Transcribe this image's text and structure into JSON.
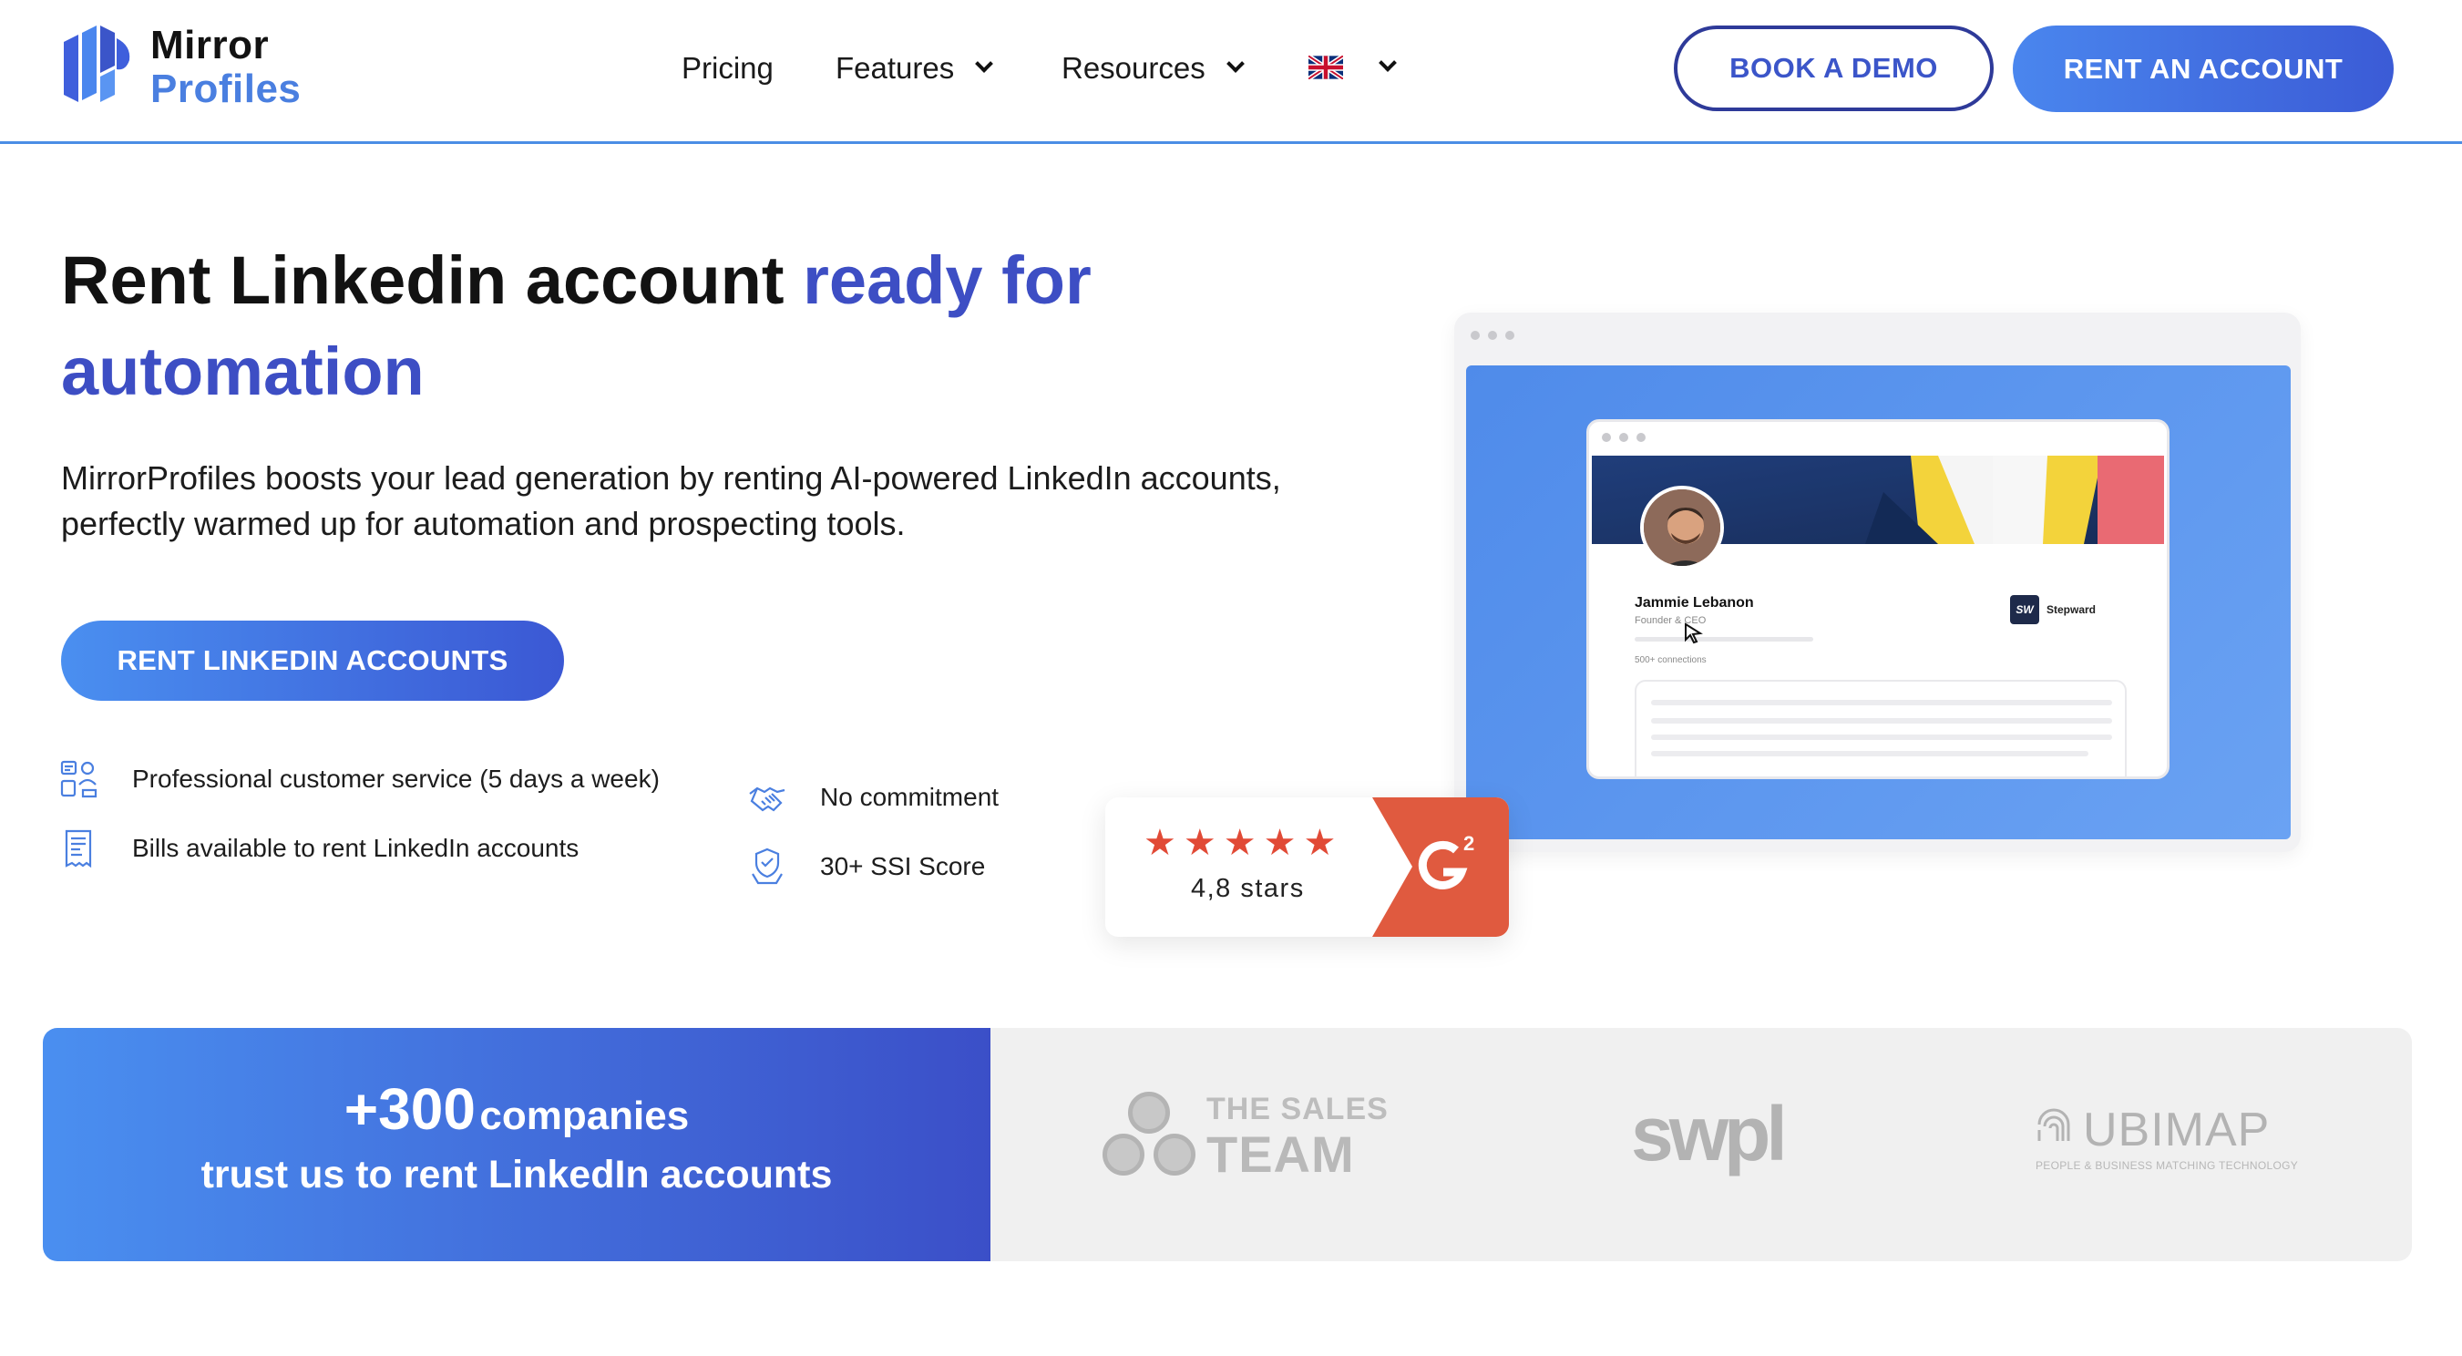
{
  "header": {
    "logo": {
      "line1": "Mirror",
      "line2": "Profiles"
    },
    "nav": [
      {
        "label": "Pricing",
        "has_dropdown": false
      },
      {
        "label": "Features",
        "has_dropdown": true
      },
      {
        "label": "Resources",
        "has_dropdown": true
      }
    ],
    "language_icon": "uk-flag-icon",
    "book_demo_label": "BOOK A DEMO",
    "rent_account_label": "RENT AN ACCOUNT"
  },
  "hero": {
    "title_plain": "Rent Linkedin account ",
    "title_accent": "ready for automation",
    "subtitle": "MirrorProfiles boosts your lead generation by renting AI-powered LinkedIn accounts, perfectly warmed up for automation and prospecting tools.",
    "cta_label": "RENT LINKEDIN ACCOUNTS",
    "features": [
      {
        "icon": "customer-service-icon",
        "text": "Professional customer service (5 days a week)"
      },
      {
        "icon": "bill-icon",
        "text": "Bills available to rent LinkedIn accounts"
      },
      {
        "icon": "handshake-icon",
        "text": "No commitment"
      },
      {
        "icon": "ssi-score-icon",
        "text": "30+ SSI Score"
      }
    ]
  },
  "mockup": {
    "profile_name": "Jammie Lebanon",
    "profile_role": "Founder & CEO",
    "connections": "500+ connections",
    "company_name": "Stepward",
    "company_logo_text": "SW"
  },
  "g2_badge": {
    "stars": 5,
    "rating_text": "4,8 stars",
    "brand_icon": "g2-icon",
    "accent_color": "#e05a3f"
  },
  "trust": {
    "count": "+300",
    "count_suffix": "companies",
    "line2": "trust us to rent LinkedIn accounts",
    "logos": {
      "sales_team_top": "THE SALES",
      "sales_team_bottom": "TEAM",
      "swpl": "swpl",
      "ubimap": "UBIMAP",
      "ubimap_tagline": "PEOPLE & BUSINESS MATCHING TECHNOLOGY"
    }
  },
  "colors": {
    "brand_blue": "#4a8ff0",
    "brand_indigo": "#3b4fc8",
    "accent_text": "#3d4ec4",
    "g2_red": "#e05a3f"
  }
}
